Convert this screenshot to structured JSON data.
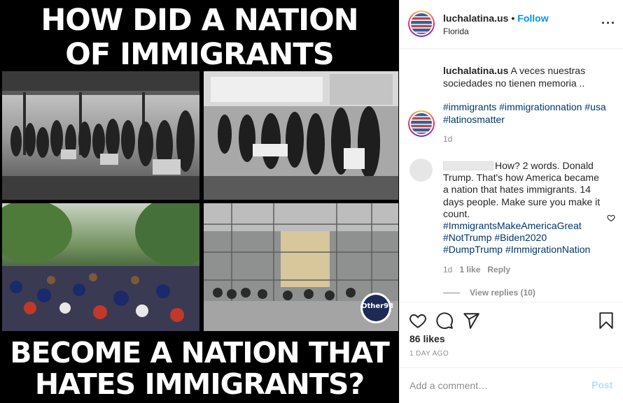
{
  "image": {
    "headline_line1": "HOW DID A NATION",
    "headline_line2": "OF IMMIGRANTS",
    "headline_line3": "BECOME A NATION THAT",
    "headline_line4": "HATES IMMIGRANTS?",
    "watermark": "Other98"
  },
  "header": {
    "username": "luchalatina.us",
    "separator": "•",
    "follow_label": "Follow",
    "location": "Florida",
    "more_icon": "more-horizontal-icon"
  },
  "caption": {
    "username": "luchalatina.us",
    "text": "A veces nuestras sociedades no tienen memoria ..",
    "hashtags": "#immigrants #immigrationnation #usa #latinosmatter",
    "time": "1d"
  },
  "comment": {
    "text": "How? 2 words. Donald Trump. That's how America became a nation that hates immigrants. 14 days people. Make sure you make it count.",
    "hashtags_line1": "#ImmigrantsMakeAmericaGreat",
    "hashtags_line2": "#NotTrump #Biden2020",
    "hashtags_line3": "#DumpTrump #ImmigrationNation",
    "time": "1d",
    "likes": "1 like",
    "reply_label": "Reply",
    "view_replies": "View replies (10)"
  },
  "actions": {
    "likes": "86 likes",
    "date": "1 DAY AGO"
  },
  "add_comment": {
    "placeholder": "Add a comment…",
    "post_label": "Post"
  },
  "colors": {
    "link_blue": "#0095f6",
    "hashtag": "#00376b",
    "muted": "#8e8e8e",
    "post_disabled": "#b2dffc"
  }
}
